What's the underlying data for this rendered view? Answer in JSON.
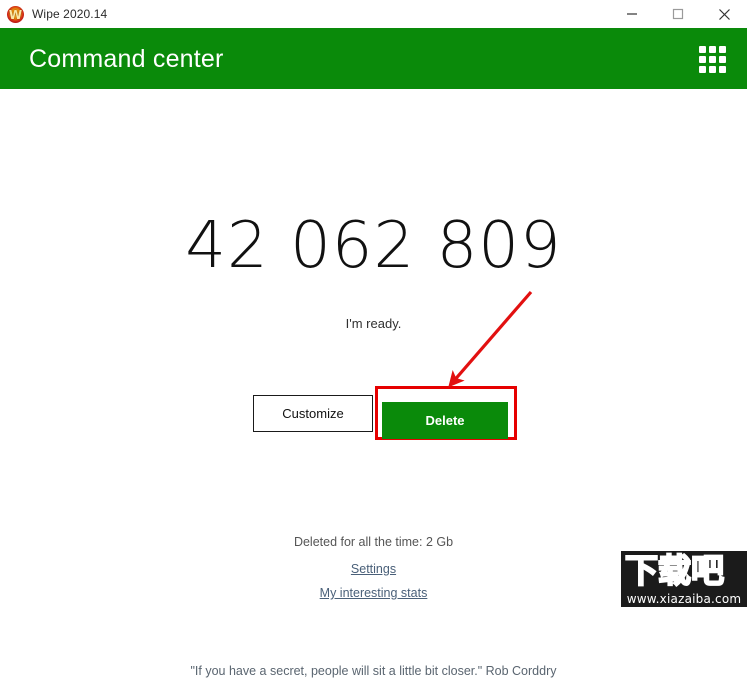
{
  "window": {
    "title": "Wipe 2020.14",
    "logo_icon": "wipe-logo-icon",
    "controls": {
      "minimize": "minimize-icon",
      "maximize": "maximize-icon",
      "close": "close-icon"
    }
  },
  "header": {
    "title": "Command center",
    "grid_icon": "apps-grid-icon",
    "background_color": "#0a8a0a"
  },
  "main": {
    "counter": "42 062 809",
    "status": "I'm ready.",
    "customize_label": "Customize",
    "delete_label": "Delete",
    "deleted_total": "Deleted for all the time: 2 Gb",
    "settings_link": "Settings",
    "stats_link": "My interesting stats",
    "quote": "\"If you have a secret, people will sit a little bit closer.\" Rob Corddry"
  },
  "annotation": {
    "highlight_color": "#e60000",
    "arrow_icon": "red-arrow-icon",
    "target": "delete-button"
  },
  "watermark": {
    "characters": "下载吧",
    "url": "www.xiazaiba.com"
  }
}
